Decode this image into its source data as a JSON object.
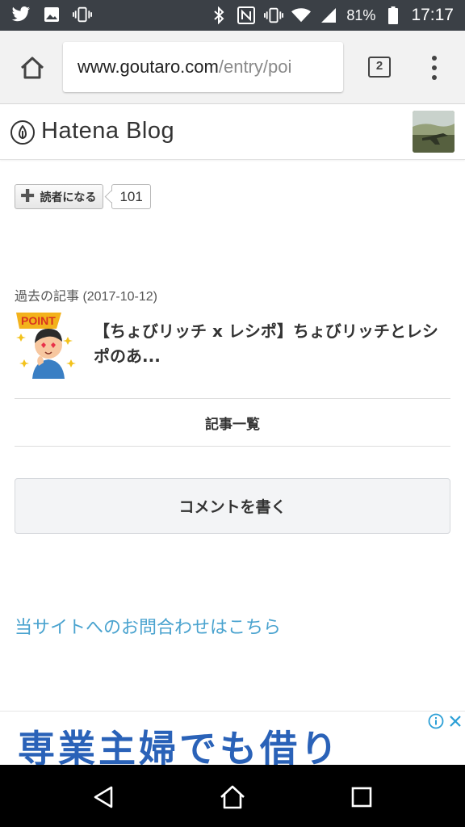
{
  "status_bar": {
    "left_icons": [
      "twitter-icon",
      "image-icon",
      "vibrate-icon"
    ],
    "right_icons": [
      "bluetooth-icon",
      "nfc-icon",
      "vibrate-icon",
      "wifi-icon",
      "signal-icon"
    ],
    "battery": "81%",
    "time": "17:17"
  },
  "browser": {
    "url_host": "www.goutaro.com",
    "url_path": "/entry/poi",
    "tab_count": "2"
  },
  "header": {
    "logo_text": "Hatena Blog"
  },
  "subscribe": {
    "label": "読者になる",
    "count": "101"
  },
  "past_article": {
    "label": "過去の記事 (2017-10-12)",
    "thumb_badge": "POINT",
    "title": "【ちょびリッチ x レシポ】ちょびリッチとレシポのあ..."
  },
  "archive_link": "記事一覧",
  "comment_button": "コメントを書く",
  "contact_link": "当サイトへのお問合わせはこちら",
  "ad": {
    "text": "専業主婦でも借り"
  },
  "colors": {
    "status_bar": "#3b4046",
    "link": "#4aa3cf",
    "ad_text": "#2a62b8"
  }
}
